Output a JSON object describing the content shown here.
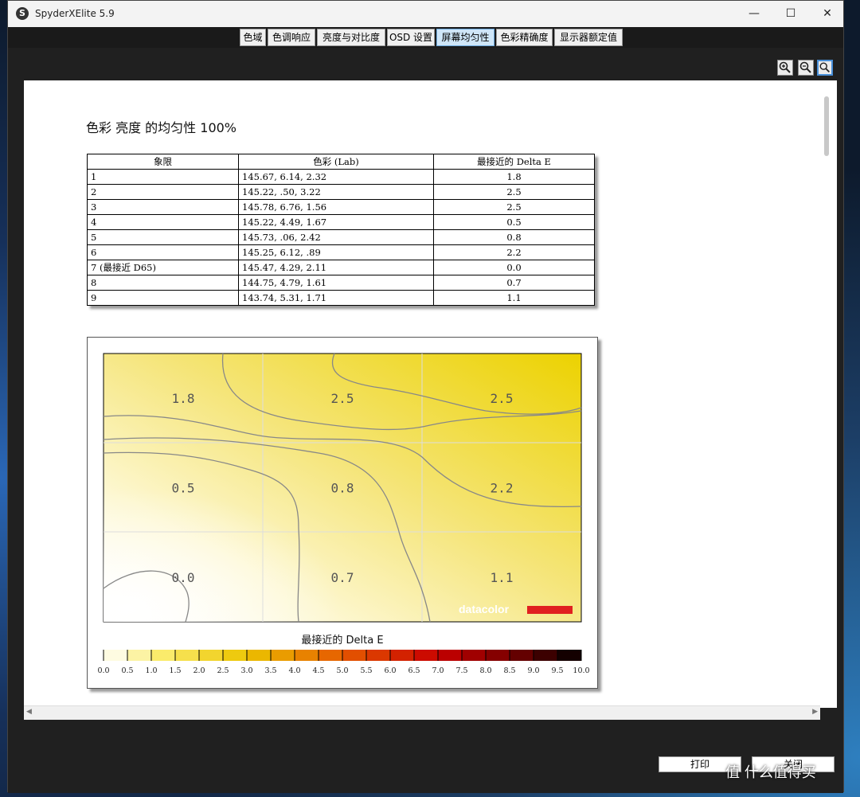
{
  "window": {
    "title": "SpyderXElite 5.9",
    "icon": "S"
  },
  "tabs": [
    {
      "label": "色域"
    },
    {
      "label": "色调响应"
    },
    {
      "label": "亮度与对比度"
    },
    {
      "label": "OSD 设置"
    },
    {
      "label": "屏幕均匀性",
      "active": true
    },
    {
      "label": "色彩精确度"
    },
    {
      "label": "显示器额定值"
    }
  ],
  "zoom_tools": [
    "zoom-in-icon",
    "zoom-out-icon",
    "zoom-fit-icon"
  ],
  "report": {
    "title": "色彩 亮度 的均匀性 100%",
    "table": {
      "headers": [
        "象限",
        "色彩 (Lab)",
        "最接近的 Delta E"
      ],
      "rows": [
        {
          "q": "1",
          "lab": "145.67,    6.14,    2.32",
          "de": "1.8"
        },
        {
          "q": "2",
          "lab": "145.22,     .50,    3.22",
          "de": "2.5"
        },
        {
          "q": "3",
          "lab": "145.78,    6.76,    1.56",
          "de": "2.5"
        },
        {
          "q": "4",
          "lab": "145.22,    4.49,    1.67",
          "de": "0.5"
        },
        {
          "q": "5",
          "lab": "145.73,     .06,    2.42",
          "de": "0.8"
        },
        {
          "q": "6",
          "lab": "145.25,    6.12,     .89",
          "de": "2.2"
        },
        {
          "q": "7 (最接近 D65)",
          "lab": "145.47,    4.29,    2.11",
          "de": "0.0"
        },
        {
          "q": "8",
          "lab": "144.75,    4.79,    1.61",
          "de": "0.7"
        },
        {
          "q": "9",
          "lab": "143.74,    5.31,    1.71",
          "de": "1.1"
        }
      ]
    }
  },
  "chart_data": {
    "type": "heatmap",
    "grid": [
      [
        "1.8",
        "2.5",
        "2.5"
      ],
      [
        "0.5",
        "0.8",
        "2.2"
      ],
      [
        "0.0",
        "0.7",
        "1.1"
      ]
    ],
    "values": [
      [
        1.8,
        2.5,
        2.5
      ],
      [
        0.5,
        0.8,
        2.2
      ],
      [
        0.0,
        0.7,
        1.1
      ]
    ],
    "legend_title": "最接近的 Delta E",
    "scale_ticks": [
      "0.0",
      "0.5",
      "1.0",
      "1.5",
      "2.0",
      "2.5",
      "3.0",
      "3.5",
      "4.0",
      "4.5",
      "5.0",
      "5.5",
      "6.0",
      "6.5",
      "7.0",
      "7.5",
      "8.0",
      "8.5",
      "9.0",
      "9.5",
      "10.0"
    ],
    "range": [
      0,
      10
    ],
    "logo": "datacolor"
  },
  "buttons": {
    "print": "打印",
    "close": "关闭"
  },
  "watermark": "值 什么值得买",
  "colors": {
    "accent": "#4a90d9",
    "heat_low": "#ffffff",
    "heat_high": "#e8c900",
    "logo_bar": "#e02020"
  }
}
